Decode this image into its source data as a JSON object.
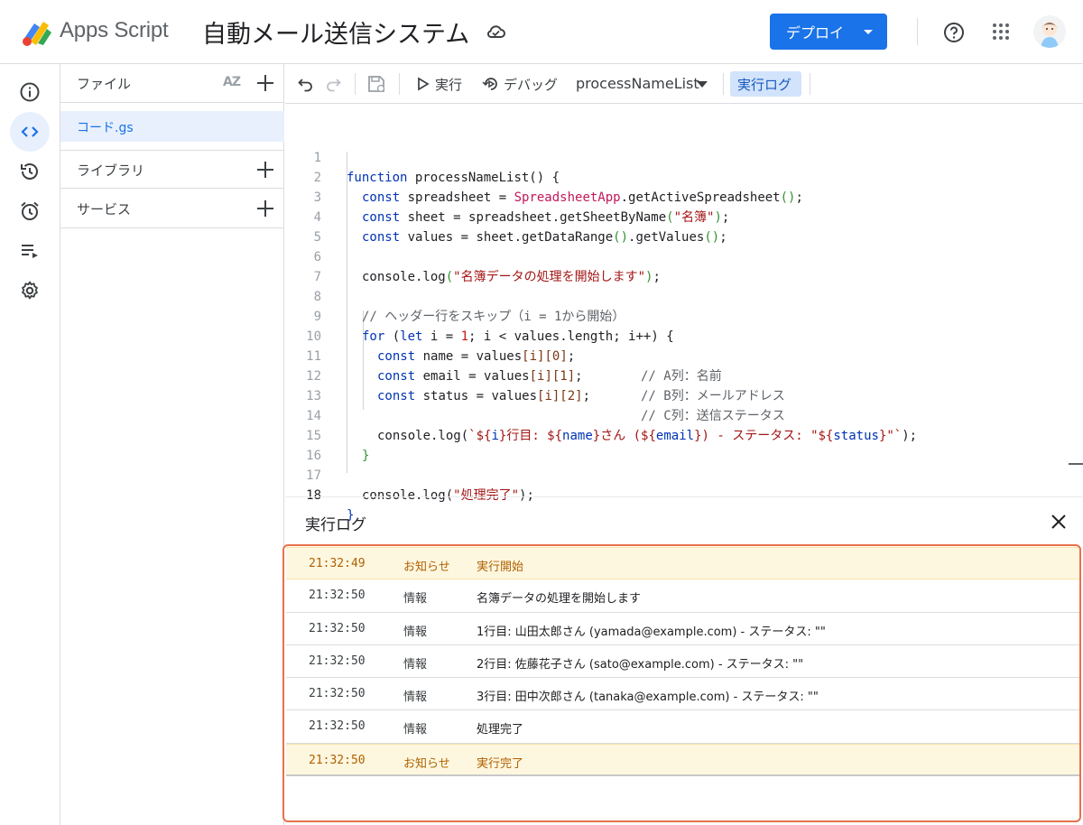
{
  "header": {
    "app_name": "Apps Script",
    "project_title": "自動メール送信システム",
    "deploy_label": "デプロイ",
    "icons": [
      "apps-script-logo",
      "cloud-saved-icon",
      "help-icon",
      "apps-grid-icon",
      "avatar"
    ]
  },
  "rail": {
    "items": [
      "info-icon",
      "code-icon",
      "history-icon",
      "alarm-icon",
      "executions-icon",
      "settings-icon"
    ],
    "active": "code-icon"
  },
  "files_panel": {
    "files_label": "ファイル",
    "sort_icon": "AZ",
    "file_name": "コード.gs",
    "libraries_label": "ライブラリ",
    "services_label": "サービス"
  },
  "toolbar": {
    "run_label": "実行",
    "debug_label": "デバッグ",
    "function_name": "processNameList",
    "log_label": "実行ログ"
  },
  "editor": {
    "line_numbers": [
      "1",
      "2",
      "3",
      "4",
      "5",
      "6",
      "7",
      "8",
      "9",
      "10",
      "11",
      "12",
      "13",
      "14",
      "15",
      "16",
      "17",
      "18"
    ],
    "current_line": "18",
    "t": {
      "l1a": "function",
      "l1b": " processNameList",
      "l1c": "() {",
      "const": "const",
      "let": "let",
      "for": "for",
      "l2a": " spreadsheet = ",
      "l2b": "SpreadsheetApp",
      "l2c": ".getActiveSpreadsheet",
      "paren_empty": "()",
      "semi": ";",
      "l3a": " sheet = spreadsheet.getSheetByName",
      "l3b": "\"名簿\"",
      "l4a": " values = sheet.getDataRange",
      "l4b": ".getValues",
      "l6a": "console.log",
      "l6b": "\"名簿データの処理を開始します\"",
      "l8": "// ヘッダー行をスキップ（i = 1から開始）",
      "l9a": " (",
      "l9b": " i = ",
      "l9c": "1",
      "l9d": "; i < values.length; i++",
      "l9e": ") {",
      "l10a": " name = values",
      "l10b": "[i][0]",
      "l10c": "// A列：名前",
      "l11a": " email = values",
      "l11b": "[i][1]",
      "l11c": "// B列：メールアドレス",
      "l12a": " status = values",
      "l12b": "[i][2]",
      "l12c": "// C列：送信ステータス",
      "l14a": "console.log(",
      "l14b": "`${",
      "l14c": "i",
      "l14d": "}行目: ${",
      "l14e": "name",
      "l14f": "}さん (${",
      "l14g": "email",
      "l14h": "}) - ステータス: \"${",
      "l14i": "status",
      "l14j": "}\"`",
      "l14k": ");",
      "close_brace": "}",
      "l17a": "console.log(",
      "l17b": "\"処理完了\"",
      "l17c": ");"
    }
  },
  "log_panel": {
    "title": "実行ログ",
    "rows": [
      {
        "time": "21:32:49",
        "level": "お知らせ",
        "message": "実行開始"
      },
      {
        "time": "21:32:50",
        "level": "情報",
        "message": "名簿データの処理を開始します"
      },
      {
        "time": "21:32:50",
        "level": "情報",
        "message": "1行目: 山田太郎さん (yamada@example.com) - ステータス: \"\""
      },
      {
        "time": "21:32:50",
        "level": "情報",
        "message": "2行目: 佐藤花子さん (sato@example.com) - ステータス: \"\""
      },
      {
        "time": "21:32:50",
        "level": "情報",
        "message": "3行目: 田中次郎さん (tanaka@example.com) - ステータス: \"\""
      },
      {
        "time": "21:32:50",
        "level": "情報",
        "message": "処理完了"
      },
      {
        "time": "21:32:50",
        "level": "お知らせ",
        "message": "実行完了"
      }
    ]
  },
  "colors": {
    "accent": "#1a73e8",
    "notice_bg": "#fef7e0",
    "notice_text": "#b06000",
    "highlight_frame": "#e8714a"
  }
}
